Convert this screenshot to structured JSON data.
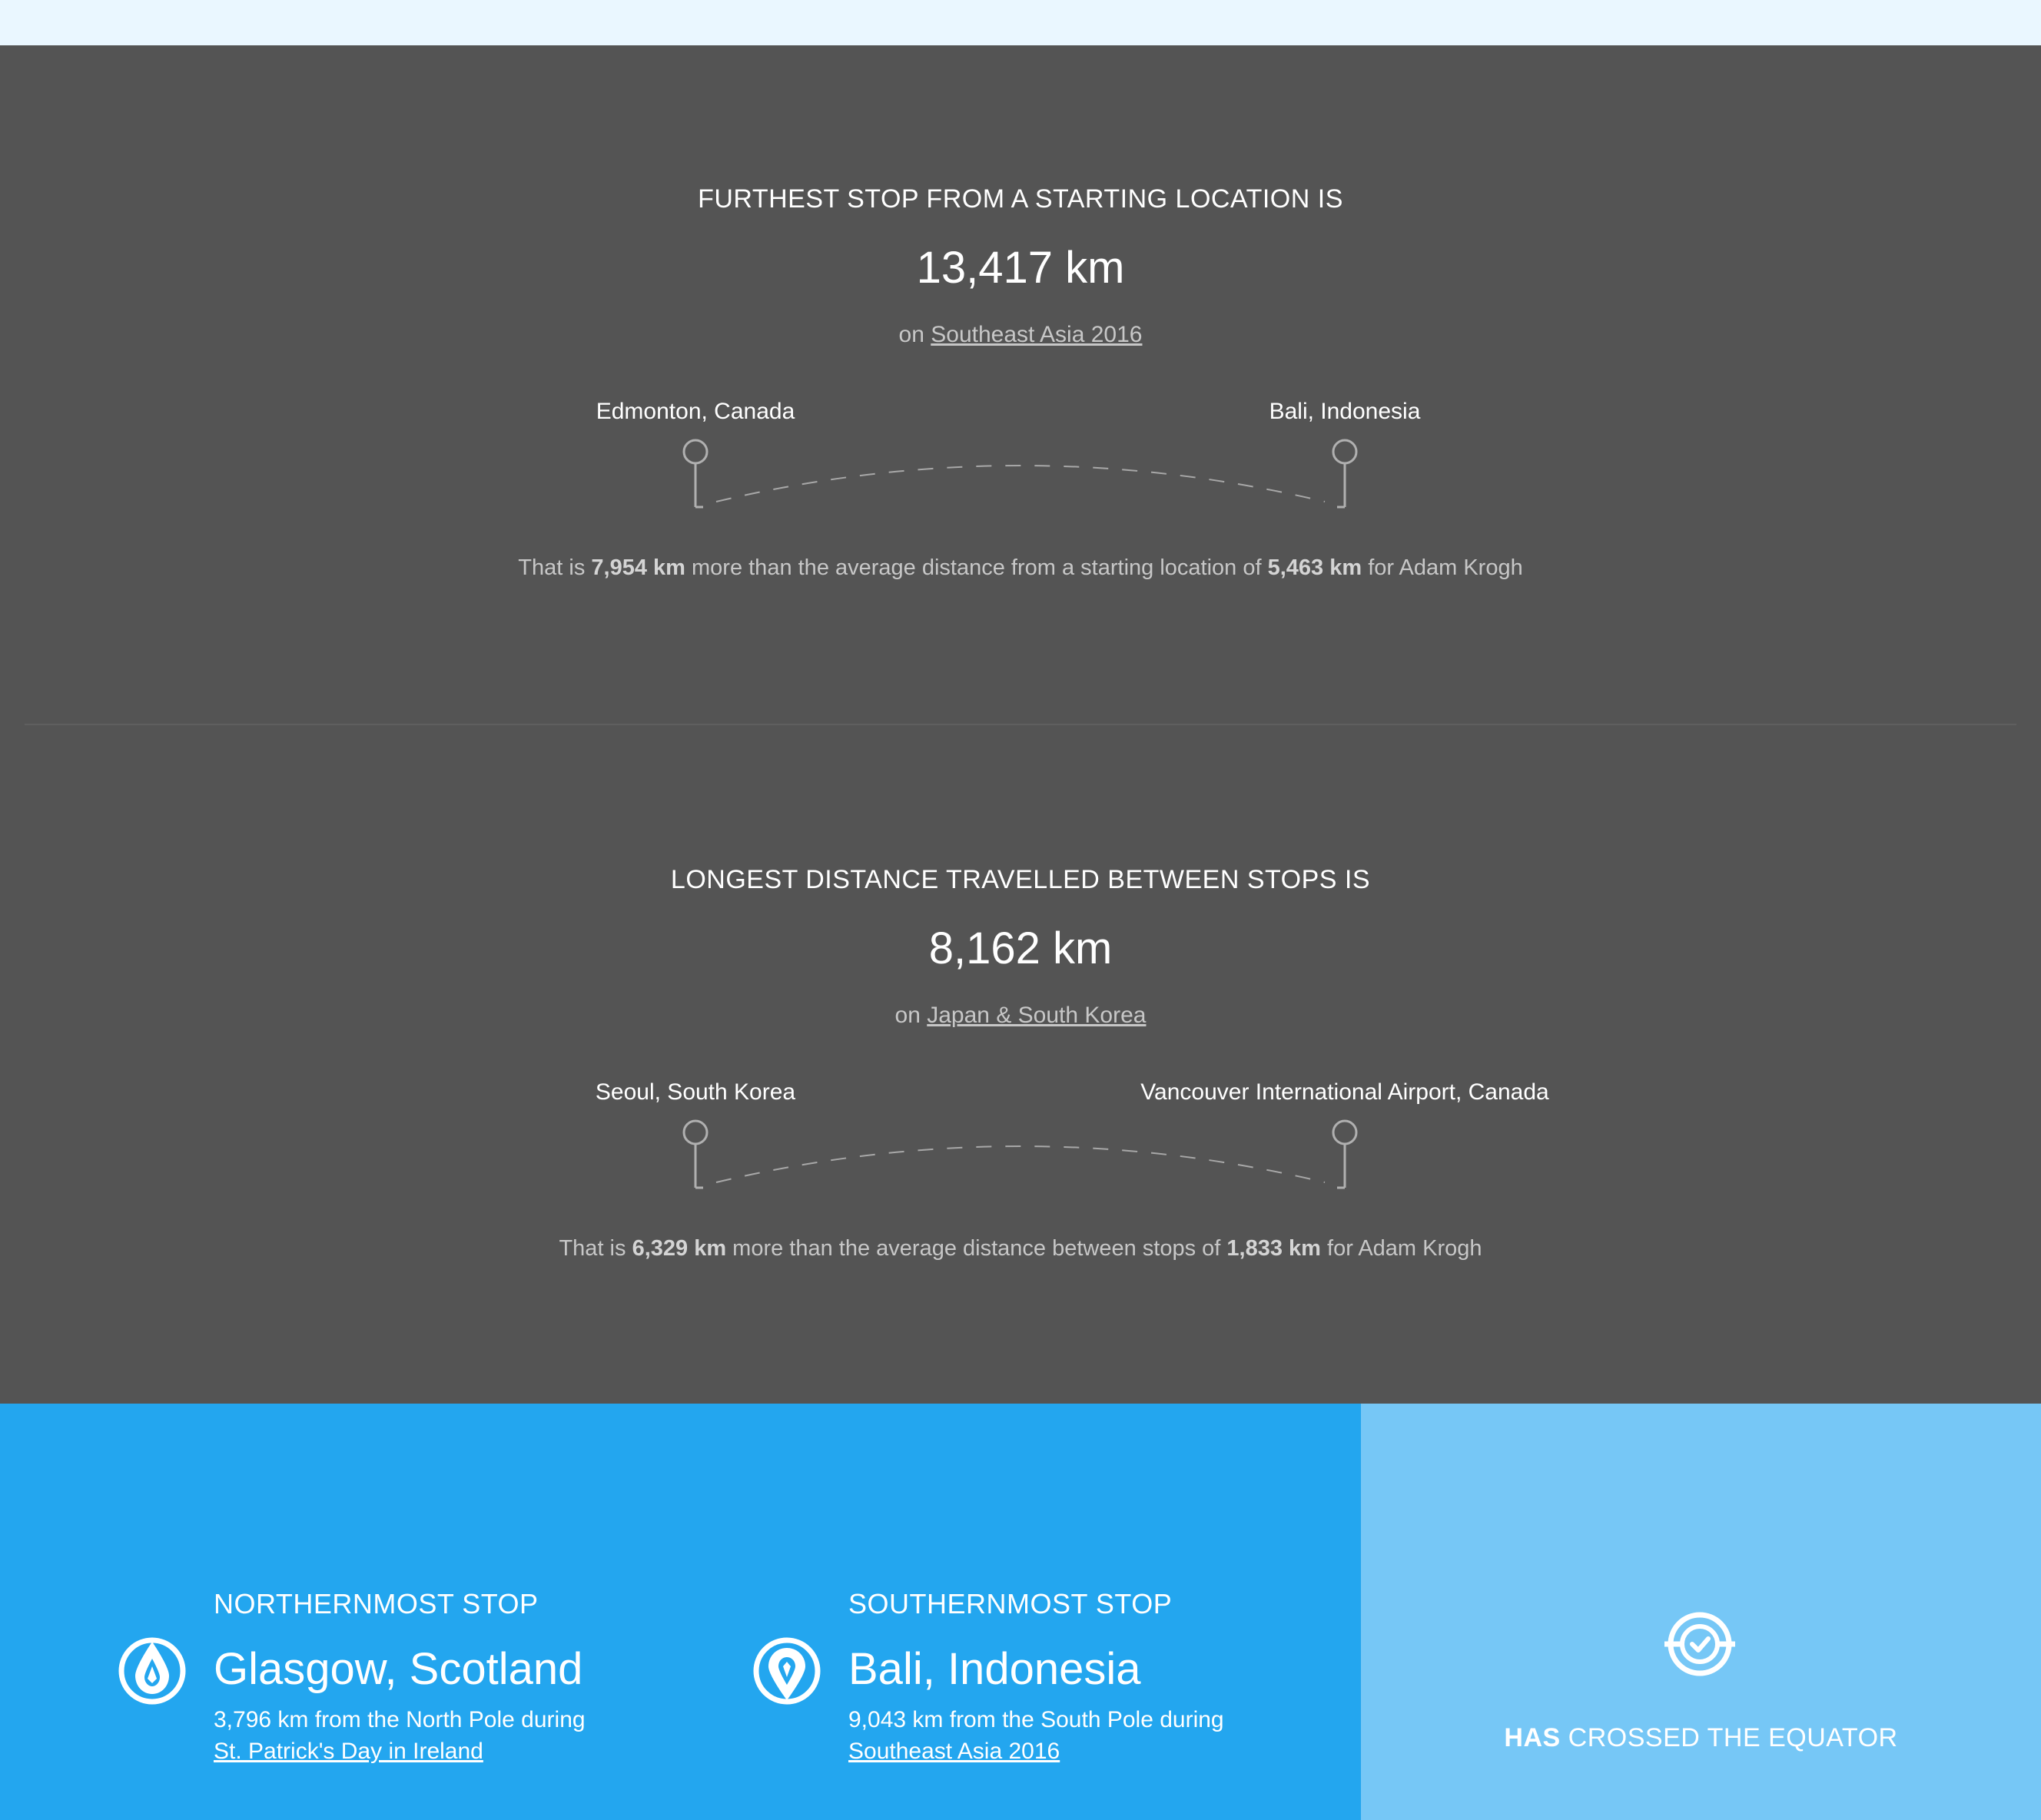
{
  "furthest": {
    "heading": "FURTHEST STOP FROM A STARTING LOCATION IS",
    "value": "13,417 km",
    "trip_prefix": "on",
    "trip_name": "Southeast Asia 2016",
    "from": "Edmonton, Canada",
    "to": "Bali, Indonesia",
    "compare_prefix": "That is",
    "compare_diff": "7,954 km",
    "compare_middle": "more than the average distance from a starting location of",
    "compare_avg": "5,463 km",
    "compare_suffix": "for Adam Krogh"
  },
  "longest": {
    "heading": "LONGEST DISTANCE TRAVELLED BETWEEN STOPS IS",
    "value": "8,162 km",
    "trip_prefix": "on",
    "trip_name": "Japan & South Korea",
    "from": "Seoul, South Korea",
    "to": "Vancouver International Airport, Canada",
    "compare_prefix": "That is",
    "compare_diff": "6,329 km",
    "compare_middle": "more than the average distance between stops of",
    "compare_avg": "1,833 km",
    "compare_suffix": "for Adam Krogh"
  },
  "northernmost": {
    "label": "NORTHERNMOST STOP",
    "place": "Glasgow, Scotland",
    "desc": "3,796 km from the North Pole during",
    "trip_name": "St. Patrick's Day in Ireland",
    "icon": "north-pin-icon"
  },
  "southernmost": {
    "label": "SOUTHERNMOST STOP",
    "place": "Bali, Indonesia",
    "desc": "9,043 km from the South Pole during",
    "trip_name": "Southeast Asia 2016",
    "icon": "south-pin-icon"
  },
  "equator": {
    "bold": "HAS",
    "rest": "CROSSED THE EQUATOR",
    "icon": "equator-check-icon"
  },
  "colors": {
    "dark_bg": "#545454",
    "blue_bg": "#23a6ef",
    "light_blue_bg": "#76c7f6",
    "top_bg": "#eaf7ff"
  }
}
